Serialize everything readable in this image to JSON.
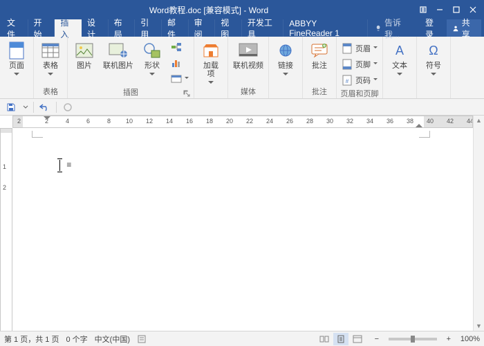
{
  "titlebar": {
    "title": "Word教程.doc [兼容模式] - Word"
  },
  "tabs": {
    "file": "文件",
    "home": "开始",
    "insert": "插入",
    "design": "设计",
    "layout": "布局",
    "references": "引用",
    "mailings": "邮件",
    "review": "审阅",
    "view": "视图",
    "developer": "开发工具",
    "abbyy": "ABBYY FineReader 1",
    "tell_me": "告诉我...",
    "login": "登录",
    "share": "共享"
  },
  "ribbon": {
    "pages": {
      "label": "页面",
      "cover": "页面"
    },
    "tables": {
      "label": "表格",
      "table": "表格"
    },
    "illustrations": {
      "label": "插图",
      "pictures": "图片",
      "online_pictures": "联机图片",
      "shapes": "形状"
    },
    "addins": {
      "label": "加载项",
      "addin": "加载\n项"
    },
    "media": {
      "label": "媒体",
      "online_video": "联机视频"
    },
    "links": {
      "label": "链接",
      "link": "链接"
    },
    "comments": {
      "label": "批注",
      "comment": "批注"
    },
    "header_footer": {
      "label": "页眉和页脚",
      "header": "页眉",
      "footer": "页脚",
      "page_number": "页码"
    },
    "text_group": {
      "label": "文本",
      "textbox": "文本"
    },
    "symbols": {
      "label": "符号",
      "symbol": "符号"
    }
  },
  "ruler": {
    "ticks": [
      2,
      2,
      4,
      6,
      8,
      10,
      12,
      14,
      16,
      18,
      20,
      22,
      24,
      26,
      28,
      30,
      32,
      34,
      36,
      38,
      40,
      42,
      44
    ],
    "vticks": [
      1,
      2
    ]
  },
  "status": {
    "page": "第 1 页，共 1 页",
    "words": "0 个字",
    "language": "中文(中国)",
    "zoom": "100%"
  }
}
